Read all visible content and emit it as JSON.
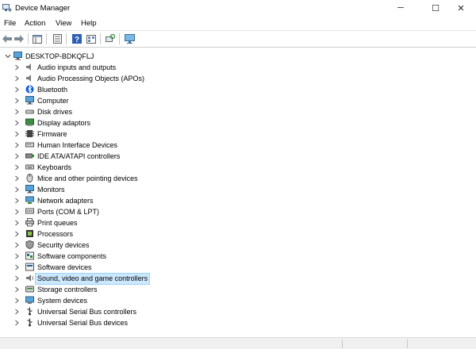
{
  "window": {
    "title": "Device Manager",
    "minimize_glyph": "─",
    "maximize_glyph": "☐",
    "close_glyph": "✕"
  },
  "menu": [
    "File",
    "Action",
    "View",
    "Help"
  ],
  "toolbar": {
    "icons": [
      "back-arrow-icon",
      "forward-arrow-icon",
      "properties-pane-icon",
      "device-list-icon",
      "help-icon",
      "view-icon",
      "scan-hardware-icon",
      "monitor-icon"
    ]
  },
  "tree": {
    "root": "DESKTOP-BDKQFLJ",
    "categories": [
      "Audio inputs and outputs",
      "Audio Processing Objects (APOs)",
      "Bluetooth",
      "Computer",
      "Disk drives",
      "Display adaptors",
      "Firmware",
      "Human Interface Devices",
      "IDE ATA/ATAPI controllers",
      "Keyboards",
      "Mice and other pointing devices",
      "Monitors",
      "Network adapters",
      "Ports (COM & LPT)",
      "Print queues",
      "Processors",
      "Security devices",
      "Software components",
      "Software devices",
      "Sound, video and game controllers",
      "Storage controllers",
      "System devices",
      "Universal Serial Bus controllers",
      "Universal Serial Bus devices"
    ],
    "selected": "Sound, video and game controllers",
    "icon_names": [
      "speaker-icon",
      "speaker-icon",
      "bluetooth-icon",
      "computer-icon",
      "disk-drive-icon",
      "display-adapter-icon",
      "firmware-icon",
      "hid-icon",
      "ide-controller-icon",
      "keyboard-icon",
      "mouse-icon",
      "monitor-icon",
      "network-adapter-icon",
      "port-icon",
      "printer-icon",
      "processor-icon",
      "security-icon",
      "software-component-icon",
      "software-device-icon",
      "sound-icon",
      "storage-icon",
      "system-icon",
      "usb-icon",
      "usb-icon"
    ]
  },
  "colors": {
    "selection_bg": "#cce8ff",
    "selection_border": "#99d1ff",
    "accent": "#0078d4"
  }
}
